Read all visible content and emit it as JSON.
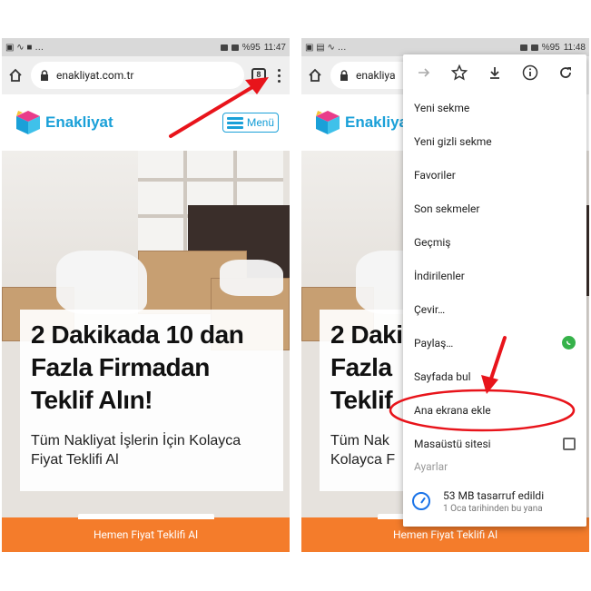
{
  "left": {
    "status": {
      "icons_left": "▣ ∿ ■ …",
      "right_text": "%95",
      "time": "11:47"
    },
    "url": "enakliyat.com.tr",
    "tab_count": "8",
    "logo": "Enakliyat",
    "menu_label": "Menü",
    "hero_title": "2 Dakikada 10 dan Fazla Firmadan Teklif Alın!",
    "hero_sub": "Tüm Nakliyat İşlerin İçin Kolayca Fiyat Teklifi Al",
    "cta": "Hemen Fiyat Teklifi Al"
  },
  "right": {
    "status": {
      "icons_left": "▣ ▤ ∿ …",
      "right_text": "%95",
      "time": "11:48"
    },
    "url": "enakliya",
    "logo": "Enakliya",
    "hero_title": "2 Daki Fazla Teklif",
    "hero_sub": "Tüm Nak Kolayca F",
    "cta": "Hemen Fiyat Teklifi Al",
    "menu": {
      "items": [
        {
          "label": "Yeni sekme"
        },
        {
          "label": "Yeni gizli sekme"
        },
        {
          "label": "Favoriler"
        },
        {
          "label": "Son sekmeler"
        },
        {
          "label": "Geçmiş"
        },
        {
          "label": "İndirilenler"
        },
        {
          "label": "Çevir…"
        },
        {
          "label": "Paylaş…"
        },
        {
          "label": "Sayfada bul"
        },
        {
          "label": "Ana ekrana ekle"
        },
        {
          "label": "Masaüstü sitesi"
        }
      ],
      "overflow_item": "Ayarlar",
      "footer_title": "53 MB tasarruf edildi",
      "footer_sub": "1 Oca tarihinden bu yana"
    }
  },
  "colors": {
    "brand_blue": "#1aa0d8",
    "cta_orange": "#f47c2b",
    "arrow_red": "#e8141b",
    "whatsapp": "#36b24a",
    "accent": "#1a73e8"
  },
  "icons": [
    "home-icon",
    "lock-icon",
    "tabs-icon",
    "kebab-menu-icon",
    "forward-icon",
    "star-icon",
    "download-icon",
    "info-icon",
    "refresh-icon",
    "whatsapp-icon",
    "data-saver-icon"
  ]
}
